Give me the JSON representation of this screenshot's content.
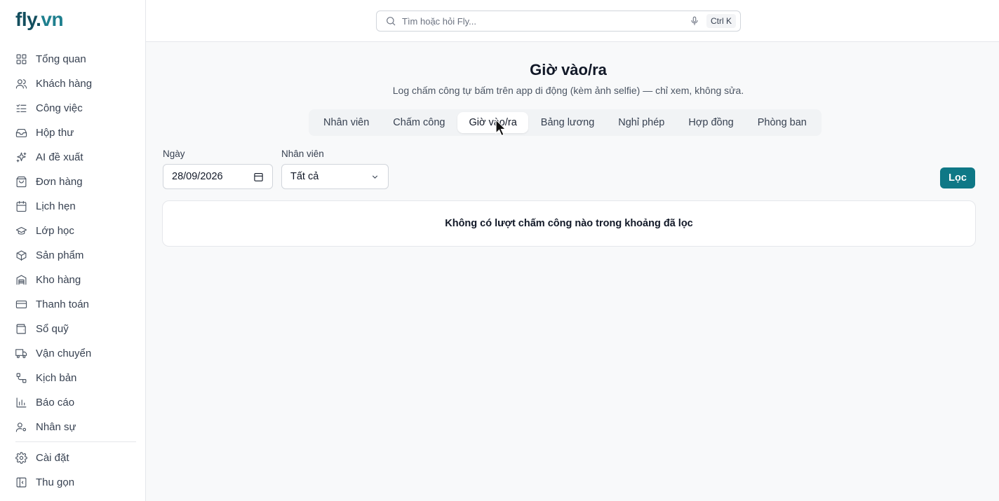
{
  "brand": {
    "part1": "fly",
    "dot": ".",
    "part2": "vn"
  },
  "search": {
    "placeholder": "Tìm hoặc hỏi Fly...",
    "shortcut": "Ctrl K"
  },
  "sidebar": {
    "items": [
      {
        "label": "Tổng quan",
        "icon": "grid-icon"
      },
      {
        "label": "Khách hàng",
        "icon": "users-icon"
      },
      {
        "label": "Công việc",
        "icon": "tasks-icon"
      },
      {
        "label": "Hộp thư",
        "icon": "inbox-icon"
      },
      {
        "label": "AI đề xuất",
        "icon": "sparkles-icon"
      },
      {
        "label": "Đơn hàng",
        "icon": "shopping-bag-icon"
      },
      {
        "label": "Lịch hẹn",
        "icon": "calendar-icon"
      },
      {
        "label": "Lớp học",
        "icon": "graduation-cap-icon"
      },
      {
        "label": "Sản phẩm",
        "icon": "package-icon"
      },
      {
        "label": "Kho hàng",
        "icon": "warehouse-icon"
      },
      {
        "label": "Thanh toán",
        "icon": "credit-card-icon"
      },
      {
        "label": "Sổ quỹ",
        "icon": "wallet-icon"
      },
      {
        "label": "Vận chuyển",
        "icon": "truck-icon"
      },
      {
        "label": "Kịch bản",
        "icon": "workflow-icon"
      },
      {
        "label": "Báo cáo",
        "icon": "bar-chart-icon"
      },
      {
        "label": "Nhân sự",
        "icon": "user-cog-icon"
      }
    ],
    "footer": [
      {
        "label": "Cài đặt",
        "icon": "gear-icon"
      },
      {
        "label": "Thu gọn",
        "icon": "panel-collapse-icon"
      }
    ]
  },
  "page": {
    "title": "Giờ vào/ra",
    "subtitle": "Log chấm công tự bấm trên app di động (kèm ảnh selfie) — chỉ xem, không sửa."
  },
  "tabs": [
    {
      "label": "Nhân viên",
      "active": false
    },
    {
      "label": "Chấm công",
      "active": false
    },
    {
      "label": "Giờ vào/ra",
      "active": true
    },
    {
      "label": "Bảng lương",
      "active": false
    },
    {
      "label": "Nghỉ phép",
      "active": false
    },
    {
      "label": "Hợp đồng",
      "active": false
    },
    {
      "label": "Phòng ban",
      "active": false
    }
  ],
  "filters": {
    "date_label": "Ngày",
    "date_value": "28/09/2026",
    "employee_label": "Nhân viên",
    "employee_value": "Tất cả",
    "submit_label": "Lọc"
  },
  "empty_message": "Không có lượt chấm công nào trong khoảng đã lọc",
  "colors": {
    "accent": "#0f7886",
    "brand_dark": "#134e5e",
    "brand_light": "#1e7f8e"
  }
}
